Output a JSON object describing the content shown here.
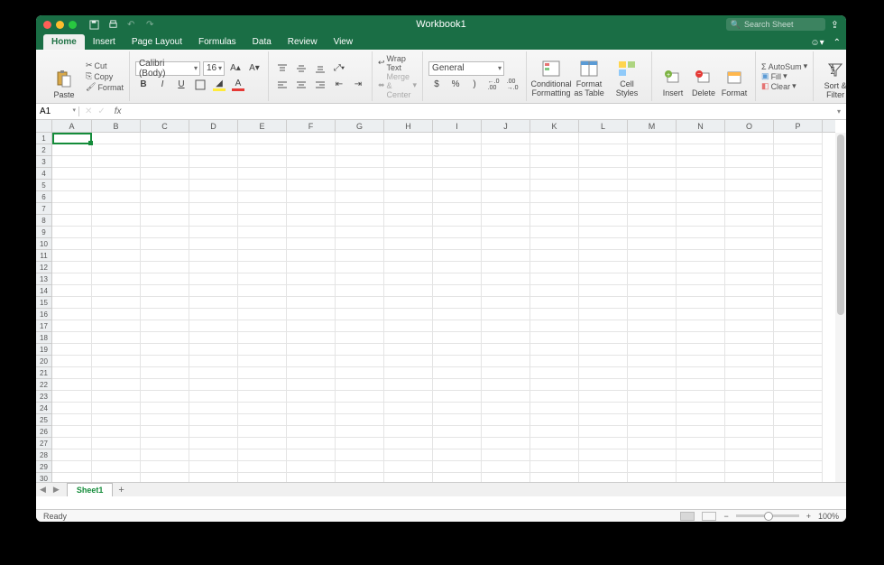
{
  "titlebar": {
    "title": "Workbook1",
    "search_placeholder": "Search Sheet"
  },
  "tabs": {
    "items": [
      "Home",
      "Insert",
      "Page Layout",
      "Formulas",
      "Data",
      "Review",
      "View"
    ],
    "active": 0
  },
  "clipboard": {
    "paste": "Paste",
    "cut": "Cut",
    "copy": "Copy",
    "format": "Format"
  },
  "font": {
    "name": "Calibri (Body)",
    "size": "16",
    "increase": "A▴",
    "decrease": "A▾",
    "bold": "B",
    "italic": "I",
    "underline": "U"
  },
  "alignment": {
    "wrap": "Wrap Text",
    "merge": "Merge & Center"
  },
  "number": {
    "format": "General",
    "currency": "$",
    "percent": "%",
    "comma": ",",
    "inc_dec": ".0",
    "dec_dec": ".00"
  },
  "styles": {
    "conditional": "Conditional\nFormatting",
    "table": "Format\nas Table",
    "cell": "Cell\nStyles"
  },
  "cells": {
    "insert": "Insert",
    "delete": "Delete",
    "format": "Format"
  },
  "editing": {
    "autosum": "AutoSum",
    "fill": "Fill",
    "clear": "Clear",
    "sort": "Sort &\nFilter"
  },
  "formula_bar": {
    "name_box": "A1",
    "fx": "fx"
  },
  "grid": {
    "columns": [
      "A",
      "B",
      "C",
      "D",
      "E",
      "F",
      "G",
      "H",
      "I",
      "J",
      "K",
      "L",
      "M",
      "N",
      "O",
      "P"
    ],
    "rows": 31,
    "active_cell": "A1"
  },
  "sheets": {
    "active": "Sheet1"
  },
  "status": {
    "text": "Ready",
    "zoom": "100%",
    "zoom_minus": "−",
    "zoom_plus": "+"
  }
}
